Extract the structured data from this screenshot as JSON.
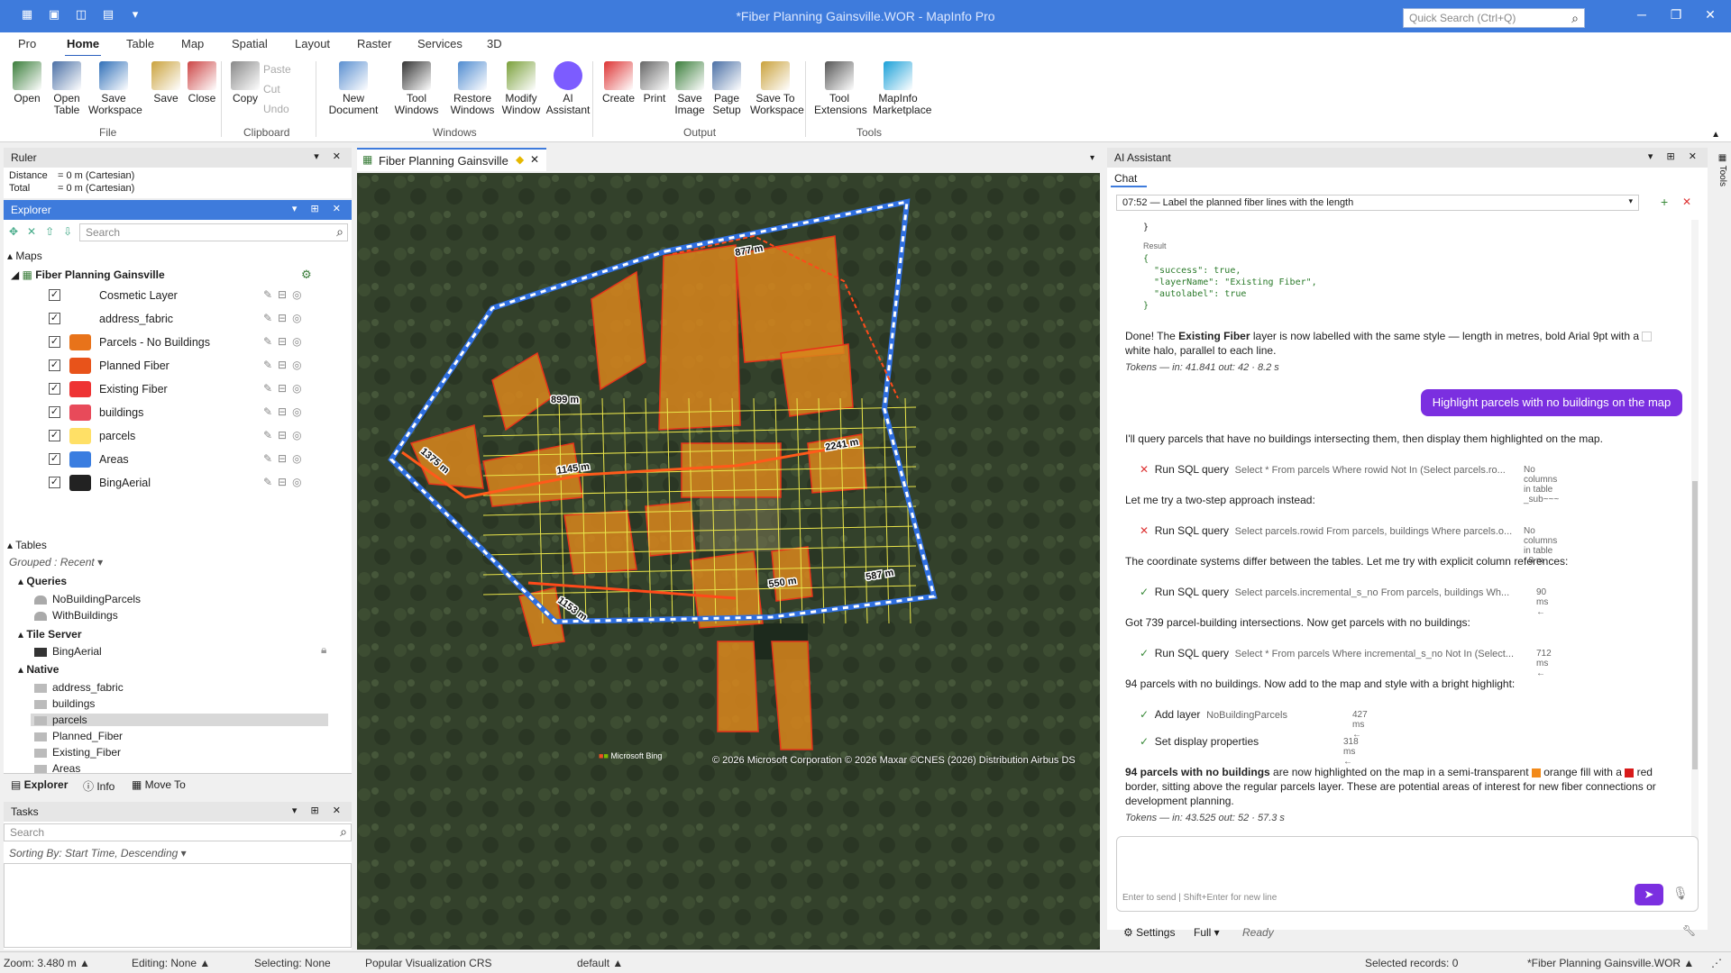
{
  "app": {
    "title": "*Fiber Planning Gainsville.WOR - MapInfo Pro",
    "quick_search_placeholder": "Quick Search (Ctrl+Q)"
  },
  "menu_tabs": [
    "Pro",
    "Home",
    "Table",
    "Map",
    "Spatial",
    "Layout",
    "Raster",
    "Services",
    "3D"
  ],
  "ribbon": {
    "buttons": [
      {
        "name": "open",
        "label": "Open",
        "color": "#3a7d3a"
      },
      {
        "name": "open-table",
        "label": "Open\nTable",
        "color": "#4a6fa5"
      },
      {
        "name": "save-workspace",
        "label": "Save\nWorkspace",
        "color": "#2f6fb8"
      },
      {
        "name": "save",
        "label": "Save",
        "color": "#caa23c"
      },
      {
        "name": "close",
        "label": "Close",
        "color": "#c44"
      },
      {
        "name": "copy",
        "label": "Copy",
        "color": "#888"
      },
      {
        "name": "new-document",
        "label": "New\nDocument",
        "color": "#5a8fd0"
      },
      {
        "name": "tool-windows",
        "label": "Tool\nWindows",
        "color": "#333"
      },
      {
        "name": "restore-windows",
        "label": "Restore\nWindows",
        "color": "#4f8bd0"
      },
      {
        "name": "modify-window",
        "label": "Modify\nWindow",
        "color": "#7aa03a"
      },
      {
        "name": "ai-assistant",
        "label": "AI\nAssistant",
        "color": "#7c5cff"
      },
      {
        "name": "create",
        "label": "Create",
        "color": "#d33"
      },
      {
        "name": "print",
        "label": "Print",
        "color": "#666"
      },
      {
        "name": "save-image",
        "label": "Save\nImage",
        "color": "#3a7d3a"
      },
      {
        "name": "page-setup",
        "label": "Page\nSetup",
        "color": "#4a6fa5"
      },
      {
        "name": "save-to-workspace",
        "label": "Save To\nWorkspace",
        "color": "#caa23c"
      },
      {
        "name": "tool-extensions",
        "label": "Tool\nExtensions",
        "color": "#555"
      },
      {
        "name": "mapinfo-marketplace",
        "label": "MapInfo\nMarketplace",
        "color": "#1aa0d8"
      }
    ],
    "small": [
      "Paste",
      "Cut",
      "Undo"
    ],
    "groups": [
      "File",
      "Clipboard",
      "Windows",
      "Output",
      "Tools"
    ]
  },
  "ruler": {
    "title": "Ruler",
    "distance_label": "Distance",
    "distance_value": "= 0 m (Cartesian)",
    "total_label": "Total",
    "total_value": "= 0 m (Cartesian)"
  },
  "explorer": {
    "title": "Explorer",
    "search_placeholder": "Search",
    "maps_label": "Maps",
    "map_name": "Fiber Planning Gainsville",
    "layers": [
      {
        "name": "Cosmetic Layer",
        "color": "transparent"
      },
      {
        "name": "address_fabric",
        "color": "transparent"
      },
      {
        "name": "Parcels - No Buildings",
        "color": "#e8731a"
      },
      {
        "name": "Planned Fiber",
        "color": "#e8531a"
      },
      {
        "name": "Existing Fiber",
        "color": "#e33"
      },
      {
        "name": "buildings",
        "color": "#e84a5a"
      },
      {
        "name": "parcels",
        "color": "#ffe066"
      },
      {
        "name": "Areas",
        "color": "#3a7de0"
      },
      {
        "name": "BingAerial",
        "color": "#222"
      }
    ],
    "tables_label": "Tables",
    "grouped_label": "Grouped : Recent",
    "queries_label": "Queries",
    "queries": [
      "NoBuildingParcels",
      "WithBuildings"
    ],
    "tile_server_label": "Tile Server",
    "tile_items": [
      "BingAerial"
    ],
    "native_label": "Native",
    "native_items": [
      "address_fabric",
      "buildings",
      "parcels",
      "Planned_Fiber",
      "Existing_Fiber",
      "Areas"
    ],
    "bottom_tabs": [
      "Explorer",
      "Info",
      "Move To"
    ]
  },
  "tasks": {
    "title": "Tasks",
    "search_placeholder": "Search",
    "sorting": "Sorting By: Start Time, Descending"
  },
  "map_window": {
    "tab_title": "Fiber Planning Gainsville",
    "labels": [
      "877 m",
      "899 m",
      "1375 m",
      "1145 m",
      "2241 m",
      "550 m",
      "587 m",
      "1153 m"
    ],
    "attribution": "© 2026 Microsoft Corporation © 2026 Maxar ©CNES (2026) Distribution Airbus DS",
    "bing_logo": "Microsoft Bing"
  },
  "ai": {
    "title": "AI Assistant",
    "chat_tab": "Chat",
    "session": "07:52 — Label the planned fiber lines with the length",
    "code_close": "}",
    "result_label": "Result",
    "code_lines": [
      "{",
      "  \"success\": true,",
      "  \"layerName\": \"Existing Fiber\",",
      "  \"autolabel\": true",
      "}"
    ],
    "msg1_pre": "Done! The ",
    "msg1_bold": "Existing Fiber",
    "msg1_post": " layer is now labelled with the same style — length in metres, bold Arial 9pt with a",
    "msg1_line2": "white halo, parallel to each line.",
    "tokens1": "Tokens — in: 41.841  out: 42  ·  8.2 s",
    "user_msg": "Highlight parcels with no buildings on the map",
    "a1": "I'll query parcels that have no buildings intersecting them, then display them highlighted on the map.",
    "tool1_name": "Run SQL query",
    "tool1_q": "Select * From parcels Where rowid Not In (Select parcels.ro...",
    "tool1_meta": "No columns in table _sub~~~",
    "a2": "Let me try a two-step approach instead:",
    "tool2_name": "Run SQL query",
    "tool2_q": "Select parcels.rowid From parcels, buildings Where parcels.o...",
    "tool2_meta": "No columns in table .   8 m",
    "a3": "The coordinate systems differ between the tables. Let me try with explicit column references:",
    "tool3_name": "Run SQL query",
    "tool3_q": "Select parcels.incremental_s_no From parcels, buildings Wh...",
    "tool3_meta": "90 ms ←",
    "a4": "Got 739 parcel-building intersections. Now get parcels with no buildings:",
    "tool4_name": "Run SQL query",
    "tool4_q": "Select * From parcels Where incremental_s_no Not In (Select...",
    "tool4_meta": "712 ms ←",
    "a5": "94 parcels with no buildings. Now add to the map and style with a bright highlight:",
    "tool5_name": "Add layer",
    "tool5_q": "NoBuildingParcels",
    "tool5_meta": "427 ms ←",
    "tool6_name": "Set display properties",
    "tool6_meta": "318 ms ←",
    "final_bold": "94 parcels with no buildings",
    "final_a": " are now highlighted on the map in a semi-transparent ",
    "final_b": "orange fill with a ",
    "final_c": "red",
    "final_line2": "border, sitting above the regular parcels layer. These are potential areas of interest for new fiber connections or",
    "final_line3": "development planning.",
    "tokens2": "Tokens — in: 43.525  out: 52  ·  57.3 s",
    "input_hint": "Enter to send  |  Shift+Enter for new line",
    "settings": "Settings",
    "full": "Full",
    "ready": "Ready"
  },
  "statusbar": {
    "zoom": "Zoom: 3.480 m",
    "editing": "Editing: None",
    "selecting": "Selecting: None",
    "crs": "Popular Visualization CRS",
    "style": "default",
    "selected": "Selected records: 0",
    "workspace": "*Fiber Planning Gainsville.WOR"
  },
  "colors": {
    "accent": "#3e7bdc",
    "user_bubble": "#7b2fe0",
    "parcel_fill": "#d9861c",
    "parcel_border": "#e8331a",
    "boundary_blue": "#2f6fe0"
  }
}
